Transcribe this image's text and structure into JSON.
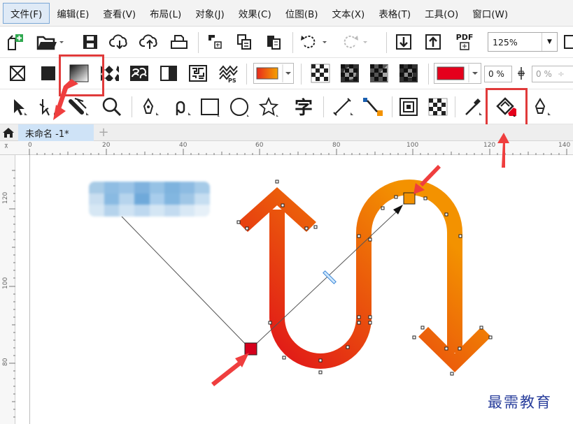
{
  "menu": {
    "items": [
      {
        "label": "文件(F)",
        "active": true
      },
      {
        "label": "编辑(E)"
      },
      {
        "label": "查看(V)"
      },
      {
        "label": "布局(L)"
      },
      {
        "label": "对象(J)"
      },
      {
        "label": "效果(C)"
      },
      {
        "label": "位图(B)"
      },
      {
        "label": "文本(X)"
      },
      {
        "label": "表格(T)"
      },
      {
        "label": "工具(O)"
      },
      {
        "label": "窗口(W)"
      }
    ]
  },
  "toolbar1": {
    "pdf_label": "PDF",
    "zoom_value": "125%"
  },
  "toolbar2": {
    "fill_color": "#e5001c",
    "gradient_start": "#e8291c",
    "gradient_end": "#f5a200",
    "transparency_value": "0 %",
    "transparency_value_2": "0 %"
  },
  "toolbar3": {
    "text_tool_glyph": "字"
  },
  "document": {
    "tab_title": "未命名 -1*",
    "add_tab": "+"
  },
  "rulers": {
    "horizontal": [
      "0",
      "20",
      "40",
      "60",
      "80",
      "100",
      "120",
      "140"
    ],
    "vertical": [
      "120",
      "100",
      "80"
    ],
    "unit": "mm"
  },
  "canvas": {
    "gradient_start_color": "#e0101a",
    "gradient_end_color": "#f39200",
    "start_node_color": "#d5001c",
    "end_node_color": "#f39200",
    "annotation_color": "#ef3e3e"
  },
  "watermark": "最需教育"
}
